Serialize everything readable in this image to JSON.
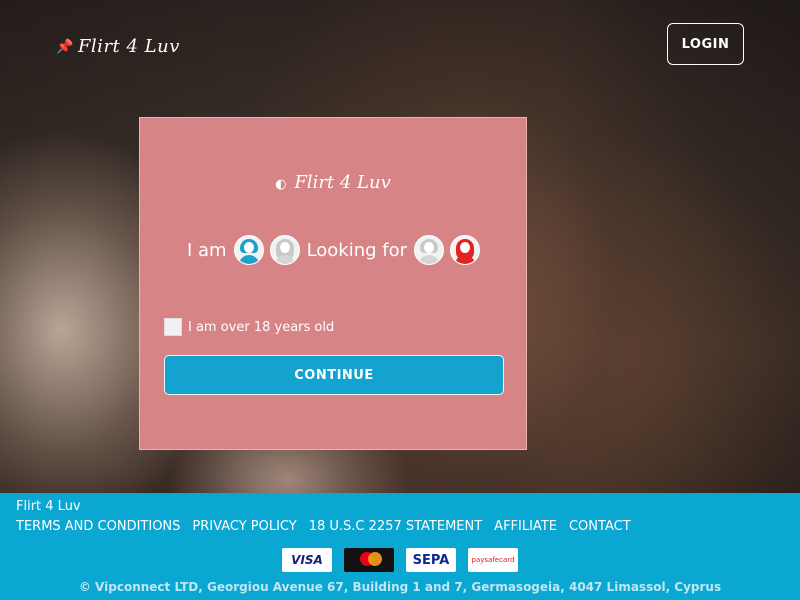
{
  "header": {
    "brand": "Flirt 4 Luv",
    "login_label": "LOGIN"
  },
  "card": {
    "logo": "Flirt 4 Luv",
    "i_am_label": "I am",
    "looking_for_label": "Looking for",
    "age_label": "I am over 18 years old",
    "continue_label": "CONTINUE"
  },
  "footer": {
    "brand": "Flirt 4 Luv",
    "links": [
      "TERMS AND CONDITIONS",
      "PRIVACY POLICY",
      "18 U.S.C 2257 STATEMENT",
      "AFFILIATE",
      "CONTACT"
    ],
    "payments": [
      "VISA",
      "mastercard",
      "SEPA",
      "paysafecard"
    ],
    "copyright": "© Vipconnect LTD, Georgiou Avenue 67, Building 1 and 7, Germasogeia, 4047 Limassol, Cyprus"
  },
  "colors": {
    "card": "#d78487",
    "footer": "#0aa7d2",
    "button": "#14a3cf"
  }
}
